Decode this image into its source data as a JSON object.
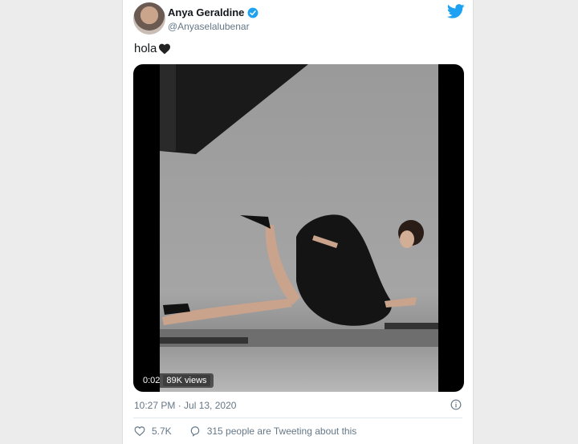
{
  "tweet": {
    "author_name": "Anya Geraldine",
    "handle": "@Anyaselalubenar",
    "text": "hola",
    "emoji": "black-heart-icon",
    "video_time": "0:02",
    "views": "89K views",
    "timestamp": "10:27 PM · Jul 13, 2020",
    "likes": "5.7K",
    "conversation": "315 people are Tweeting about this"
  },
  "colors": {
    "twitter_blue": "#1da1f2",
    "muted": "#657786",
    "text": "#14171a"
  }
}
